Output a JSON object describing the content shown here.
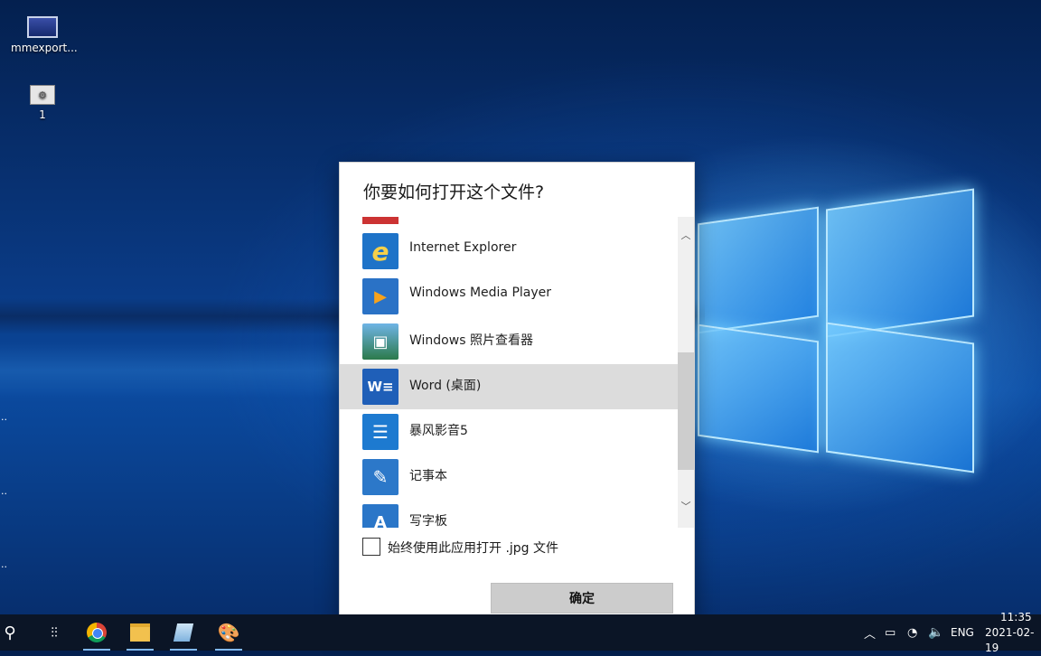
{
  "desktop": {
    "icons": [
      {
        "label": "mmexport..."
      },
      {
        "label": "1"
      }
    ]
  },
  "dialog": {
    "title": "你要如何打开这个文件?",
    "apps": [
      {
        "label": "Internet Explorer",
        "icon": "internet-explorer-icon",
        "glyph": "e"
      },
      {
        "label": "Windows Media Player",
        "icon": "media-player-icon",
        "glyph": "▶"
      },
      {
        "label": "Windows 照片查看器",
        "icon": "photo-viewer-icon",
        "glyph": "▣"
      },
      {
        "label": "Word (桌面)",
        "icon": "word-icon",
        "glyph": "W"
      },
      {
        "label": "暴风影音5",
        "icon": "baofeng-icon",
        "glyph": "☰"
      },
      {
        "label": "记事本",
        "icon": "notepad-icon",
        "glyph": "✎"
      },
      {
        "label": "写字板",
        "icon": "wordpad-icon",
        "glyph": "A"
      }
    ],
    "always_use_label": "始终使用此应用打开 .jpg 文件",
    "ok_label": "确定"
  },
  "taskbar": {
    "language": "ENG",
    "time": "11:35",
    "date": "2021-02-19"
  },
  "colors": {
    "accent": "#0078d7",
    "selection": "#dcdcdc",
    "taskbar": "#0b1526"
  }
}
